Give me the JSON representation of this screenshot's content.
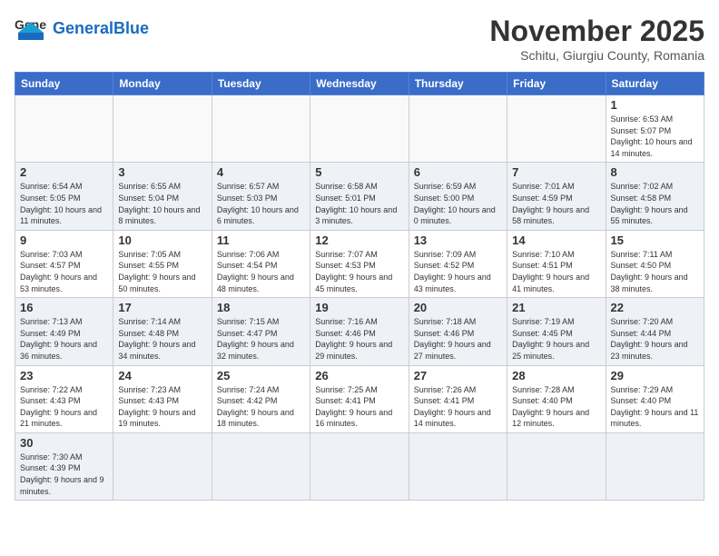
{
  "header": {
    "logo_general": "General",
    "logo_blue": "Blue",
    "month_title": "November 2025",
    "location": "Schitu, Giurgiu County, Romania"
  },
  "days_of_week": [
    "Sunday",
    "Monday",
    "Tuesday",
    "Wednesday",
    "Thursday",
    "Friday",
    "Saturday"
  ],
  "weeks": [
    [
      {
        "day": "",
        "info": ""
      },
      {
        "day": "",
        "info": ""
      },
      {
        "day": "",
        "info": ""
      },
      {
        "day": "",
        "info": ""
      },
      {
        "day": "",
        "info": ""
      },
      {
        "day": "",
        "info": ""
      },
      {
        "day": "1",
        "info": "Sunrise: 6:53 AM\nSunset: 5:07 PM\nDaylight: 10 hours and 14 minutes."
      }
    ],
    [
      {
        "day": "2",
        "info": "Sunrise: 6:54 AM\nSunset: 5:05 PM\nDaylight: 10 hours and 11 minutes."
      },
      {
        "day": "3",
        "info": "Sunrise: 6:55 AM\nSunset: 5:04 PM\nDaylight: 10 hours and 8 minutes."
      },
      {
        "day": "4",
        "info": "Sunrise: 6:57 AM\nSunset: 5:03 PM\nDaylight: 10 hours and 6 minutes."
      },
      {
        "day": "5",
        "info": "Sunrise: 6:58 AM\nSunset: 5:01 PM\nDaylight: 10 hours and 3 minutes."
      },
      {
        "day": "6",
        "info": "Sunrise: 6:59 AM\nSunset: 5:00 PM\nDaylight: 10 hours and 0 minutes."
      },
      {
        "day": "7",
        "info": "Sunrise: 7:01 AM\nSunset: 4:59 PM\nDaylight: 9 hours and 58 minutes."
      },
      {
        "day": "8",
        "info": "Sunrise: 7:02 AM\nSunset: 4:58 PM\nDaylight: 9 hours and 55 minutes."
      }
    ],
    [
      {
        "day": "9",
        "info": "Sunrise: 7:03 AM\nSunset: 4:57 PM\nDaylight: 9 hours and 53 minutes."
      },
      {
        "day": "10",
        "info": "Sunrise: 7:05 AM\nSunset: 4:55 PM\nDaylight: 9 hours and 50 minutes."
      },
      {
        "day": "11",
        "info": "Sunrise: 7:06 AM\nSunset: 4:54 PM\nDaylight: 9 hours and 48 minutes."
      },
      {
        "day": "12",
        "info": "Sunrise: 7:07 AM\nSunset: 4:53 PM\nDaylight: 9 hours and 45 minutes."
      },
      {
        "day": "13",
        "info": "Sunrise: 7:09 AM\nSunset: 4:52 PM\nDaylight: 9 hours and 43 minutes."
      },
      {
        "day": "14",
        "info": "Sunrise: 7:10 AM\nSunset: 4:51 PM\nDaylight: 9 hours and 41 minutes."
      },
      {
        "day": "15",
        "info": "Sunrise: 7:11 AM\nSunset: 4:50 PM\nDaylight: 9 hours and 38 minutes."
      }
    ],
    [
      {
        "day": "16",
        "info": "Sunrise: 7:13 AM\nSunset: 4:49 PM\nDaylight: 9 hours and 36 minutes."
      },
      {
        "day": "17",
        "info": "Sunrise: 7:14 AM\nSunset: 4:48 PM\nDaylight: 9 hours and 34 minutes."
      },
      {
        "day": "18",
        "info": "Sunrise: 7:15 AM\nSunset: 4:47 PM\nDaylight: 9 hours and 32 minutes."
      },
      {
        "day": "19",
        "info": "Sunrise: 7:16 AM\nSunset: 4:46 PM\nDaylight: 9 hours and 29 minutes."
      },
      {
        "day": "20",
        "info": "Sunrise: 7:18 AM\nSunset: 4:46 PM\nDaylight: 9 hours and 27 minutes."
      },
      {
        "day": "21",
        "info": "Sunrise: 7:19 AM\nSunset: 4:45 PM\nDaylight: 9 hours and 25 minutes."
      },
      {
        "day": "22",
        "info": "Sunrise: 7:20 AM\nSunset: 4:44 PM\nDaylight: 9 hours and 23 minutes."
      }
    ],
    [
      {
        "day": "23",
        "info": "Sunrise: 7:22 AM\nSunset: 4:43 PM\nDaylight: 9 hours and 21 minutes."
      },
      {
        "day": "24",
        "info": "Sunrise: 7:23 AM\nSunset: 4:43 PM\nDaylight: 9 hours and 19 minutes."
      },
      {
        "day": "25",
        "info": "Sunrise: 7:24 AM\nSunset: 4:42 PM\nDaylight: 9 hours and 18 minutes."
      },
      {
        "day": "26",
        "info": "Sunrise: 7:25 AM\nSunset: 4:41 PM\nDaylight: 9 hours and 16 minutes."
      },
      {
        "day": "27",
        "info": "Sunrise: 7:26 AM\nSunset: 4:41 PM\nDaylight: 9 hours and 14 minutes."
      },
      {
        "day": "28",
        "info": "Sunrise: 7:28 AM\nSunset: 4:40 PM\nDaylight: 9 hours and 12 minutes."
      },
      {
        "day": "29",
        "info": "Sunrise: 7:29 AM\nSunset: 4:40 PM\nDaylight: 9 hours and 11 minutes."
      }
    ],
    [
      {
        "day": "30",
        "info": "Sunrise: 7:30 AM\nSunset: 4:39 PM\nDaylight: 9 hours and 9 minutes."
      },
      {
        "day": "",
        "info": ""
      },
      {
        "day": "",
        "info": ""
      },
      {
        "day": "",
        "info": ""
      },
      {
        "day": "",
        "info": ""
      },
      {
        "day": "",
        "info": ""
      },
      {
        "day": "",
        "info": ""
      }
    ]
  ]
}
